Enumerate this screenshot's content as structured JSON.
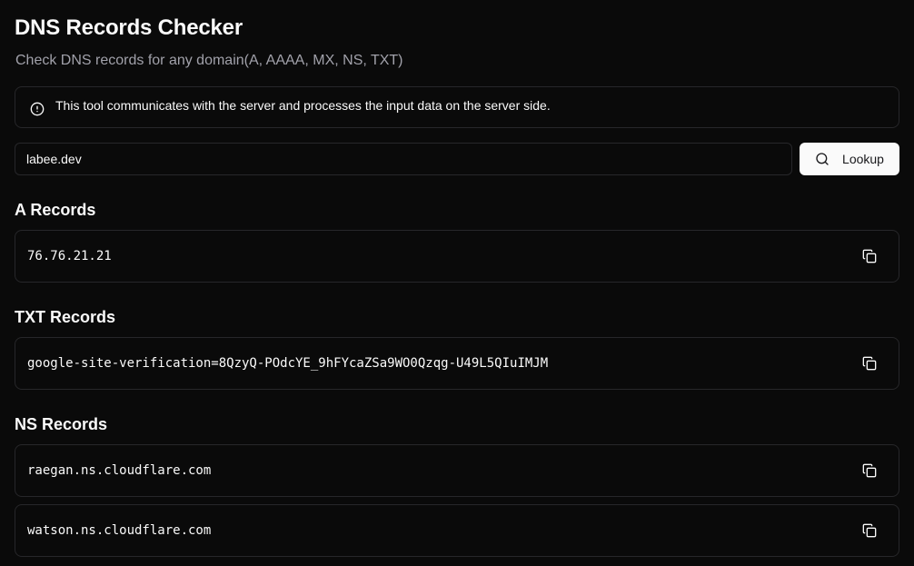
{
  "header": {
    "title": "DNS Records Checker",
    "subtitle": "Check DNS records for any domain(A, AAAA, MX, NS, TXT)"
  },
  "alert": {
    "icon": "info-circle-icon",
    "text": "This tool communicates with the server and processes the input data on the server side."
  },
  "search": {
    "value": "labee.dev",
    "button_label": "Lookup",
    "button_icon": "search-icon"
  },
  "sections": {
    "a": {
      "title": "A Records",
      "records": [
        "76.76.21.21"
      ]
    },
    "txt": {
      "title": "TXT Records",
      "records": [
        "google-site-verification=8QzyQ-POdcYE_9hFYcaZSa9WO0Qzqg-U49L5QIuIMJM"
      ]
    },
    "ns": {
      "title": "NS Records",
      "records": [
        "raegan.ns.cloudflare.com",
        "watson.ns.cloudflare.com"
      ]
    }
  },
  "colors": {
    "background": "#0a0a0a",
    "border": "#27272a",
    "muted_text": "#a1a1aa",
    "button_bg": "#fafafa",
    "button_text": "#18181b"
  }
}
